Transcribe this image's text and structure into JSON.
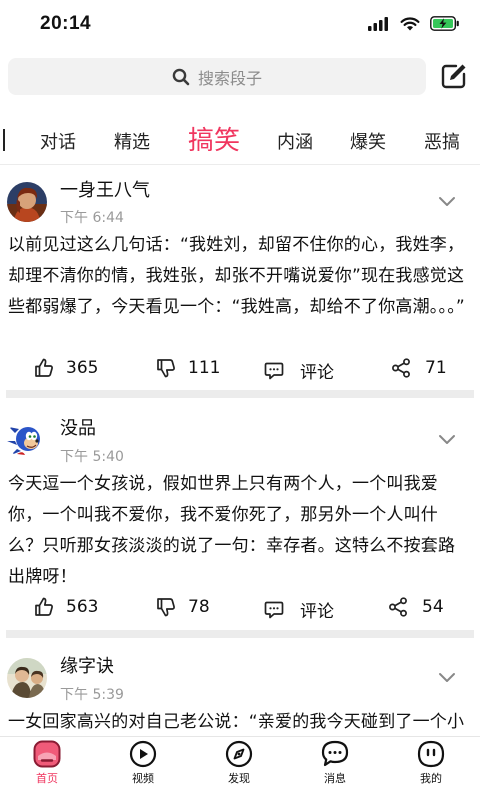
{
  "status_bar": {
    "time": "20:14"
  },
  "search": {
    "placeholder": "搜索段子"
  },
  "tabs": [
    {
      "label": "对话"
    },
    {
      "label": "精选"
    },
    {
      "label": "搞笑",
      "active": true
    },
    {
      "label": "内涵"
    },
    {
      "label": "爆笑"
    },
    {
      "label": "恶搞"
    }
  ],
  "posts": [
    {
      "author": "一身王八气",
      "time": "下午 6:44",
      "content": "以前见过这么几句话：“我姓刘，却留不住你的心，我姓李，却理不清你的情，我姓张，却张不开嘴说爱你”现在我感觉这些都弱爆了，今天看见一个：“我姓高，却给不了你高潮。。。”",
      "likes": "365",
      "dislikes": "111",
      "comment_label": "评论",
      "shares": "71"
    },
    {
      "author": "没品",
      "time": "下午 5:40",
      "content": "今天逗一个女孩说，假如世界上只有两个人，一个叫我爱你，一个叫我不爱你，我不爱你死了，那另外一个人叫什么？只听那女孩淡淡的说了一句：幸存者。这特么不按套路出牌呀！",
      "likes": "563",
      "dislikes": "78",
      "comment_label": "评论",
      "shares": "54"
    },
    {
      "author": "缘字诀",
      "time": "下午 5:39",
      "content": "一女回家高兴的对自己老公说：“亲爱的我今天碰到了一个小"
    }
  ],
  "tabbar": [
    {
      "label": "首页",
      "icon": "home-icon",
      "active": true
    },
    {
      "label": "视频",
      "icon": "play-icon"
    },
    {
      "label": "发现",
      "icon": "compass-icon"
    },
    {
      "label": "消息",
      "icon": "message-icon"
    },
    {
      "label": "我的",
      "icon": "profile-icon"
    }
  ],
  "colors": {
    "accent": "#f0365f",
    "battery": "#35c759",
    "separator": "#ececec"
  }
}
